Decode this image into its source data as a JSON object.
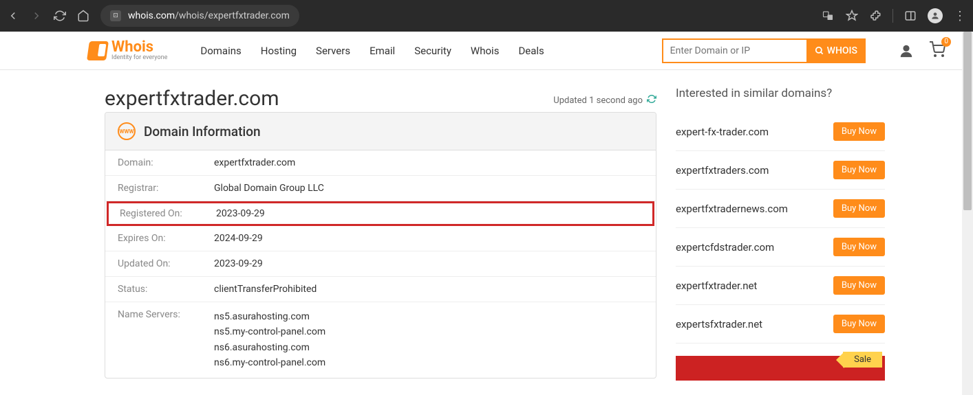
{
  "browser": {
    "url_prefix": "whois.com",
    "url_path": "/whois/expertfxtrader.com"
  },
  "logo": {
    "main": "Whois",
    "sub": "Identity for everyone"
  },
  "nav": [
    "Domains",
    "Hosting",
    "Servers",
    "Email",
    "Security",
    "Whois",
    "Deals"
  ],
  "search": {
    "placeholder": "Enter Domain or IP",
    "button": "WHOIS"
  },
  "cart_count": "0",
  "page_title": "expertfxtrader.com",
  "updated_text": "Updated 1 second ago",
  "panel_title": "Domain Information",
  "info": [
    {
      "label": "Domain:",
      "value": "expertfxtrader.com"
    },
    {
      "label": "Registrar:",
      "value": "Global Domain Group LLC"
    },
    {
      "label": "Registered On:",
      "value": "2023-09-29",
      "highlight": true
    },
    {
      "label": "Expires On:",
      "value": "2024-09-29"
    },
    {
      "label": "Updated On:",
      "value": "2023-09-29"
    },
    {
      "label": "Status:",
      "value": "clientTransferProhibited"
    },
    {
      "label": "Name Servers:",
      "values": [
        "ns5.asurahosting.com",
        "ns5.my-control-panel.com",
        "ns6.asurahosting.com",
        "ns6.my-control-panel.com"
      ]
    }
  ],
  "interest_title": "Interested in similar domains?",
  "similar": [
    "expert-fx-trader.com",
    "expertfxtraders.com",
    "expertfxtradernews.com",
    "expertcfdstrader.com",
    "expertfxtrader.net",
    "expertsfxtrader.net"
  ],
  "buy_label": "Buy Now",
  "sale_label": "Sale"
}
